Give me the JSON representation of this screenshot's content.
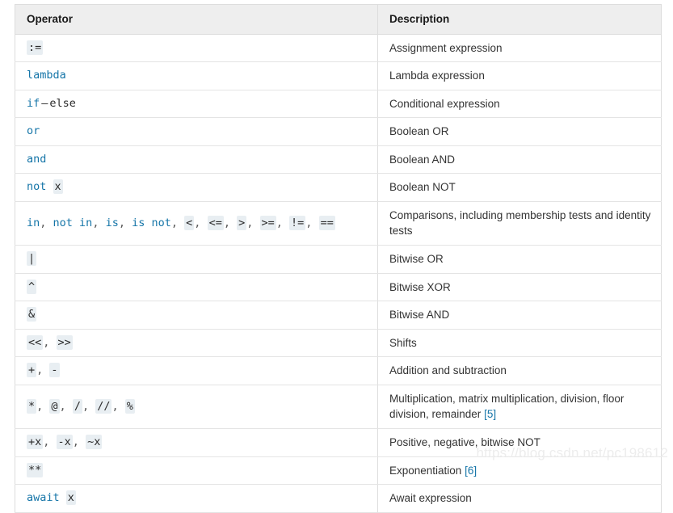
{
  "table": {
    "headers": {
      "operator": "Operator",
      "description": "Description"
    },
    "rows": [
      {
        "operator_text": ":=",
        "description": "Assignment expression",
        "tokens": [
          {
            "text": ":=",
            "style": "code"
          }
        ],
        "desc_parts": [
          {
            "text": "Assignment expression",
            "style": "plain"
          }
        ]
      },
      {
        "operator_text": "lambda",
        "description": "Lambda expression",
        "tokens": [
          {
            "text": "lambda",
            "style": "keyword"
          }
        ],
        "desc_parts": [
          {
            "text": "Lambda expression",
            "style": "plain"
          }
        ]
      },
      {
        "operator_text": "if – else",
        "description": "Conditional expression",
        "tokens": [
          {
            "text": "if",
            "style": "keyword"
          },
          {
            "text": "–",
            "style": "dash"
          },
          {
            "text": "else",
            "style": "token"
          }
        ],
        "desc_parts": [
          {
            "text": "Conditional expression",
            "style": "plain"
          }
        ]
      },
      {
        "operator_text": "or",
        "description": "Boolean OR",
        "tokens": [
          {
            "text": "or",
            "style": "keyword"
          }
        ],
        "desc_parts": [
          {
            "text": "Boolean OR",
            "style": "plain"
          }
        ]
      },
      {
        "operator_text": "and",
        "description": "Boolean AND",
        "tokens": [
          {
            "text": "and",
            "style": "keyword"
          }
        ],
        "desc_parts": [
          {
            "text": "Boolean AND",
            "style": "plain"
          }
        ]
      },
      {
        "operator_text": "not x",
        "description": "Boolean NOT",
        "tokens": [
          {
            "text": "not",
            "style": "keyword"
          },
          {
            "text": " ",
            "style": "space"
          },
          {
            "text": "x",
            "style": "code"
          }
        ],
        "desc_parts": [
          {
            "text": "Boolean NOT",
            "style": "plain"
          }
        ]
      },
      {
        "operator_text": "in, not in, is, is not, <, <=, >, >=, !=, ==",
        "description": "Comparisons, including membership tests and identity tests",
        "tokens": [
          {
            "text": "in",
            "style": "keyword"
          },
          {
            "text": ", ",
            "style": "sep"
          },
          {
            "text": "not in",
            "style": "keyword"
          },
          {
            "text": ", ",
            "style": "sep"
          },
          {
            "text": "is",
            "style": "keyword"
          },
          {
            "text": ", ",
            "style": "sep"
          },
          {
            "text": "is not",
            "style": "keyword"
          },
          {
            "text": ", ",
            "style": "sep"
          },
          {
            "text": "<",
            "style": "code"
          },
          {
            "text": ", ",
            "style": "sep"
          },
          {
            "text": "<=",
            "style": "code"
          },
          {
            "text": ", ",
            "style": "sep"
          },
          {
            "text": ">",
            "style": "code"
          },
          {
            "text": ", ",
            "style": "sep"
          },
          {
            "text": ">=",
            "style": "code"
          },
          {
            "text": ", ",
            "style": "sep"
          },
          {
            "text": "!=",
            "style": "code"
          },
          {
            "text": ", ",
            "style": "sep"
          },
          {
            "text": "==",
            "style": "code"
          }
        ],
        "desc_parts": [
          {
            "text": "Comparisons, including membership tests and identity tests",
            "style": "plain"
          }
        ]
      },
      {
        "operator_text": "|",
        "description": "Bitwise OR",
        "tokens": [
          {
            "text": "|",
            "style": "code"
          }
        ],
        "desc_parts": [
          {
            "text": "Bitwise OR",
            "style": "plain"
          }
        ]
      },
      {
        "operator_text": "^",
        "description": "Bitwise XOR",
        "tokens": [
          {
            "text": "^",
            "style": "code"
          }
        ],
        "desc_parts": [
          {
            "text": "Bitwise XOR",
            "style": "plain"
          }
        ]
      },
      {
        "operator_text": "&",
        "description": "Bitwise AND",
        "tokens": [
          {
            "text": "&",
            "style": "code"
          }
        ],
        "desc_parts": [
          {
            "text": "Bitwise AND",
            "style": "plain"
          }
        ]
      },
      {
        "operator_text": "<<, >>",
        "description": "Shifts",
        "tokens": [
          {
            "text": "<<",
            "style": "code"
          },
          {
            "text": ", ",
            "style": "sep"
          },
          {
            "text": ">>",
            "style": "code"
          }
        ],
        "desc_parts": [
          {
            "text": "Shifts",
            "style": "plain"
          }
        ]
      },
      {
        "operator_text": "+, -",
        "description": "Addition and subtraction",
        "tokens": [
          {
            "text": "+",
            "style": "code"
          },
          {
            "text": ", ",
            "style": "sep"
          },
          {
            "text": "-",
            "style": "code"
          }
        ],
        "desc_parts": [
          {
            "text": "Addition and subtraction",
            "style": "plain"
          }
        ]
      },
      {
        "operator_text": "*, @, /, //, %",
        "description": "Multiplication, matrix multiplication, division, floor division, remainder [5]",
        "tokens": [
          {
            "text": "*",
            "style": "code"
          },
          {
            "text": ", ",
            "style": "sep"
          },
          {
            "text": "@",
            "style": "code"
          },
          {
            "text": ", ",
            "style": "sep"
          },
          {
            "text": "/",
            "style": "code"
          },
          {
            "text": ", ",
            "style": "sep"
          },
          {
            "text": "//",
            "style": "code"
          },
          {
            "text": ", ",
            "style": "sep"
          },
          {
            "text": "%",
            "style": "code"
          }
        ],
        "desc_parts": [
          {
            "text": "Multiplication, matrix multiplication, division, floor division, remainder ",
            "style": "plain"
          },
          {
            "text": "[5]",
            "style": "footnote"
          }
        ]
      },
      {
        "operator_text": "+x, -x, ~x",
        "description": "Positive, negative, bitwise NOT",
        "tokens": [
          {
            "text": "+x",
            "style": "code"
          },
          {
            "text": ", ",
            "style": "sep"
          },
          {
            "text": "-x",
            "style": "code"
          },
          {
            "text": ", ",
            "style": "sep"
          },
          {
            "text": "~x",
            "style": "code"
          }
        ],
        "desc_parts": [
          {
            "text": "Positive, negative, bitwise NOT",
            "style": "plain"
          }
        ]
      },
      {
        "operator_text": "**",
        "description": "Exponentiation [6]",
        "tokens": [
          {
            "text": "**",
            "style": "code"
          }
        ],
        "desc_parts": [
          {
            "text": "Exponentiation ",
            "style": "plain"
          },
          {
            "text": "[6]",
            "style": "footnote"
          }
        ]
      },
      {
        "operator_text": "await x",
        "description": "Await expression",
        "tokens": [
          {
            "text": "await",
            "style": "keyword"
          },
          {
            "text": " ",
            "style": "space"
          },
          {
            "text": "x",
            "style": "code"
          }
        ],
        "desc_parts": [
          {
            "text": "Await expression",
            "style": "plain"
          }
        ]
      }
    ]
  },
  "watermark": {
    "text": "https://blog.csdn.net/pc198612"
  },
  "colors": {
    "keyword_blue": "#1575a8",
    "footnote_blue": "#1575a8",
    "code_bg": "#e8eef2",
    "header_bg": "#eeeeee",
    "border": "#dddddd",
    "text": "#333333",
    "watermark": "#ededed"
  }
}
